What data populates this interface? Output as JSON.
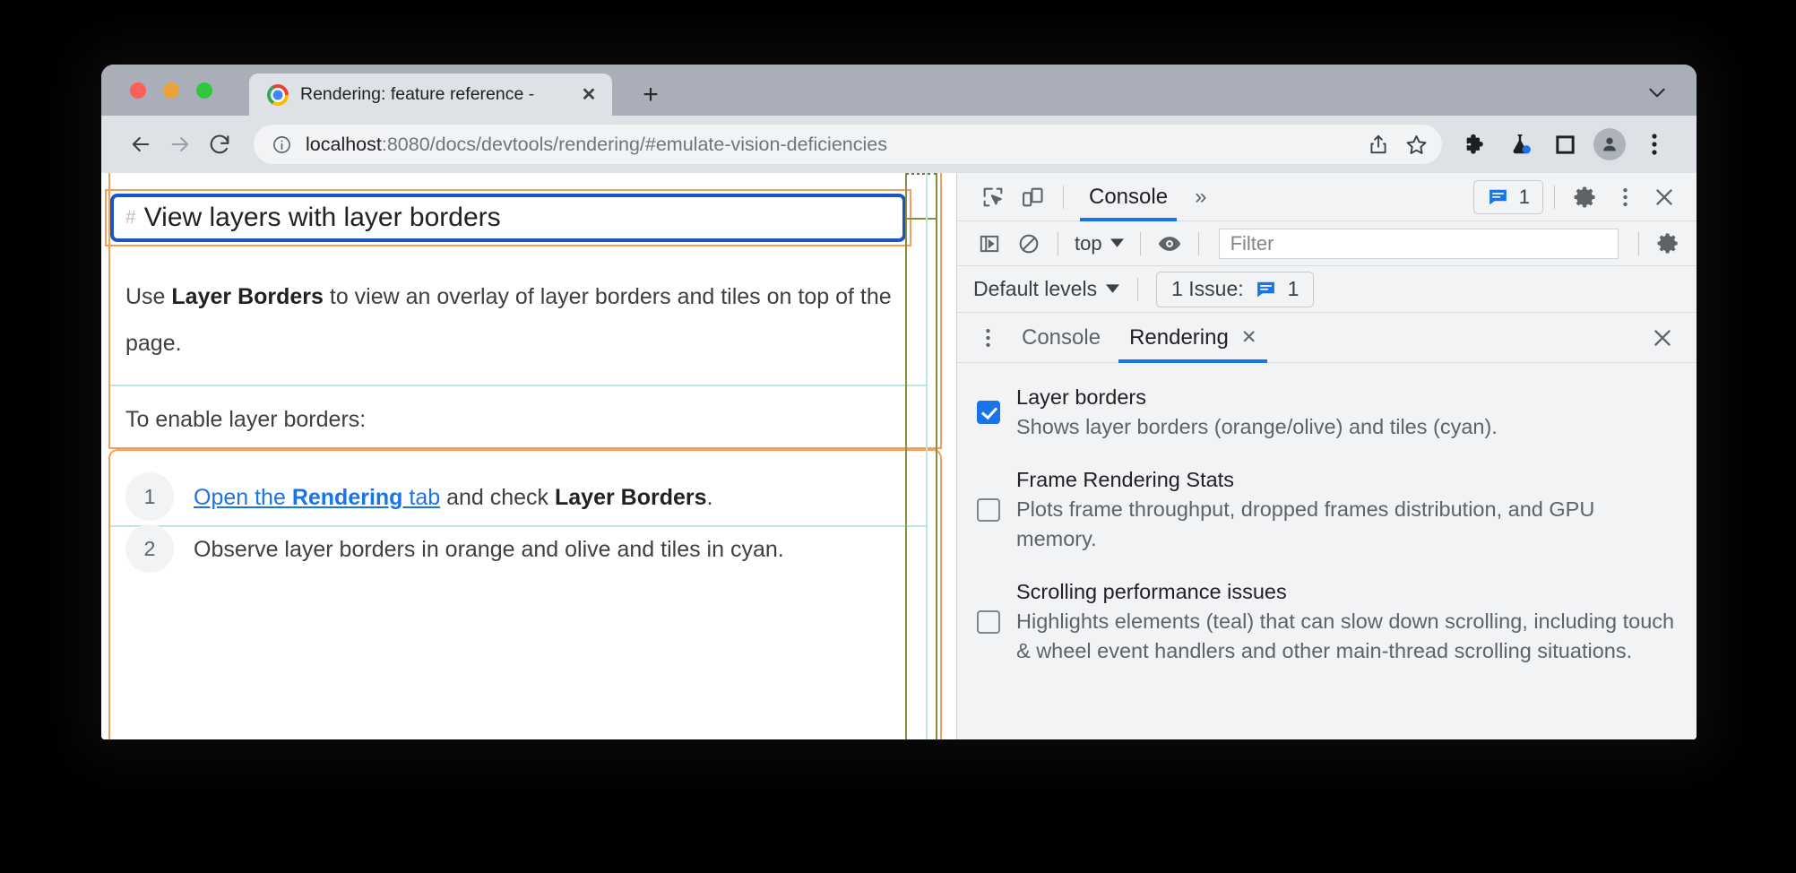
{
  "browser": {
    "tab": {
      "title": "Rendering: feature reference -",
      "favicon": "chrome-logo-icon",
      "close_label": "✕"
    },
    "new_tab_label": "+",
    "window_chevron": "chevron-down-icon",
    "toolbar": {
      "back": "back-arrow-icon",
      "forward": "forward-arrow-icon",
      "reload": "reload-icon",
      "info": "info-circle-icon",
      "url_host": "localhost",
      "url_rest": ":8080/docs/devtools/rendering/#emulate-vision-deficiencies",
      "share": "share-icon",
      "bookmark": "star-icon",
      "extensions": "puzzle-piece-icon",
      "experiments": "flask-icon",
      "side_panel": "side-panel-icon",
      "profile": "profile-avatar-icon",
      "menu": "three-dots-vertical-icon"
    }
  },
  "page": {
    "heading": {
      "anchor": "#",
      "text": "View layers with layer borders"
    },
    "paragraph1": {
      "pre": "Use ",
      "bold": "Layer Borders",
      "post": " to view an overlay of layer borders and tiles on top of the page."
    },
    "paragraph2": "To enable layer borders:",
    "steps": [
      {
        "number": "1",
        "link_pre": "Open the ",
        "link_bold": "Rendering",
        "link_post": " tab",
        "after": " and check ",
        "bold": "Layer Borders",
        "end": "."
      },
      {
        "number": "2",
        "text": "Observe layer borders in orange and olive and tiles in cyan."
      }
    ]
  },
  "devtools": {
    "top_bar": {
      "inspect": "inspect-element-icon",
      "device_toggle": "device-toolbar-icon",
      "active_panel": "Console",
      "more_panels": "»",
      "issues_count": "1",
      "issues_icon": "issue-message-icon",
      "settings": "gear-icon",
      "menu": "three-dots-vertical-icon",
      "close": "close-icon"
    },
    "console_toolbar": {
      "sidebar_toggle": "console-sidebar-icon",
      "clear": "clear-console-icon",
      "context": "top",
      "context_chevron": "chevron-down-icon",
      "eye": "eye-icon",
      "filter_placeholder": "Filter",
      "filter_value": "",
      "settings": "gear-icon"
    },
    "levels_row": {
      "levels": "Default levels",
      "levels_chevron": "chevron-down-icon",
      "issue_label": "1 Issue:",
      "issue_icon": "issue-message-icon",
      "issue_count": "1"
    },
    "drawer": {
      "menu": "three-dots-vertical-icon",
      "tabs": [
        {
          "label": "Console",
          "active": false,
          "closable": false
        },
        {
          "label": "Rendering",
          "active": true,
          "closable": true,
          "close": "✕"
        }
      ],
      "close": "close-icon"
    },
    "rendering_options": [
      {
        "title": "Layer borders",
        "description": "Shows layer borders (orange/olive) and tiles (cyan).",
        "checked": true
      },
      {
        "title": "Frame Rendering Stats",
        "description": "Plots frame throughput, dropped frames distribution, and GPU memory.",
        "checked": false
      },
      {
        "title": "Scrolling performance issues",
        "description": "Highlights elements (teal) that can slow down scrolling, including touch & wheel event handlers and other main-thread scrolling situations.",
        "checked": false
      }
    ]
  },
  "colors": {
    "layer_border_orange": "#f5a05a",
    "layer_border_olive": "#8a8f3e",
    "tile_cyan": "#bfe6e6",
    "selected_blue": "#1a55c4",
    "accent_blue": "#1a73e8",
    "chrome_tabstrip": "#a9aeb8",
    "chrome_toolbar": "#dee1e6",
    "devtools_bg": "#f1f3f4"
  }
}
